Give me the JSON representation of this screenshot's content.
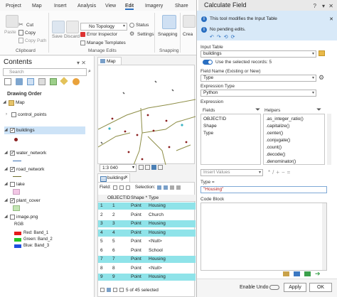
{
  "ribbon": {
    "tabs": [
      "Project",
      "Map",
      "Insert",
      "Analysis",
      "View",
      "Edit",
      "Imagery",
      "Share"
    ],
    "active_tab": "Edit",
    "clipboard": {
      "paste": "Paste",
      "cut": "Cut",
      "copy": "Copy",
      "copy_path": "Copy Path",
      "group": "Clipboard"
    },
    "manage_edits": {
      "save": "Save",
      "discard": "Discard",
      "topology": "No Topology",
      "error_inspector": "Error Inspector",
      "manage_templates": "Manage Templates",
      "status": "Status",
      "settings": "Settings",
      "group": "Manage Edits"
    },
    "snapping": {
      "label": "Snapping",
      "group": "Snapping"
    },
    "create": "Crea"
  },
  "contents": {
    "title": "Contents",
    "search_placeholder": "Search",
    "drawing_order": "Drawing Order",
    "layers": {
      "map": "Map",
      "control_points": "control_points",
      "buildings": "buildings",
      "water_network": "water_network",
      "road_network": "road_network",
      "lake": "lake",
      "plant_cover": "plant_cover",
      "image": "image.png",
      "rgb": "RGB",
      "red": "Red: Band_1",
      "green": "Green: Band_2",
      "blue": "Blue: Band_3"
    }
  },
  "map": {
    "tab": "Map",
    "scale": "1:3 040"
  },
  "table": {
    "tab": "buildings",
    "field_label": "Field:",
    "selection_label": "Selection:",
    "columns": [
      "OBJECTID",
      "Shape *",
      "Type"
    ],
    "rows": [
      {
        "id": "1",
        "shape": "Point",
        "type": "Housing",
        "selected": true
      },
      {
        "id": "2",
        "shape": "Point",
        "type": "Church",
        "selected": false
      },
      {
        "id": "3",
        "shape": "Point",
        "type": "Housing",
        "selected": true
      },
      {
        "id": "4",
        "shape": "Point",
        "type": "Housing",
        "selected": true
      },
      {
        "id": "5",
        "shape": "Point",
        "type": "<Null>",
        "selected": false
      },
      {
        "id": "6",
        "shape": "Point",
        "type": "School",
        "selected": false
      },
      {
        "id": "7",
        "shape": "Point",
        "type": "Housing",
        "selected": true
      },
      {
        "id": "8",
        "shape": "Point",
        "type": "<Null>",
        "selected": false
      },
      {
        "id": "9",
        "shape": "Point",
        "type": "Housing",
        "selected": true
      }
    ],
    "footer": "5 of 45 selected"
  },
  "calc": {
    "title": "Calculate Field",
    "info1": "This tool modifies the Input Table",
    "info2": "No pending edits.",
    "input_table_label": "Input Table",
    "input_table_value": "buildings",
    "use_selected": "Use the selected records: 5",
    "field_name_label": "Field Name (Existing or New)",
    "field_name_value": "Type",
    "expr_type_label": "Expression Type",
    "expr_type_value": "Python",
    "expression_label": "Expression",
    "fields_label": "Fields",
    "helpers_label": "Helpers",
    "fields": [
      "OBJECTID",
      "Shape",
      "Type"
    ],
    "helpers": [
      ".as_integer_ratio()",
      ".capitalize()",
      ".center()",
      ".conjugate()",
      ".count()",
      ".decode()",
      ".denominator()"
    ],
    "insert_values": "Insert Values",
    "type_eq_label": "Type =",
    "expression_value": "\"Housing\"",
    "code_block_label": "Code Block",
    "enable_undo": "Enable Undo",
    "apply": "Apply",
    "ok": "OK"
  }
}
